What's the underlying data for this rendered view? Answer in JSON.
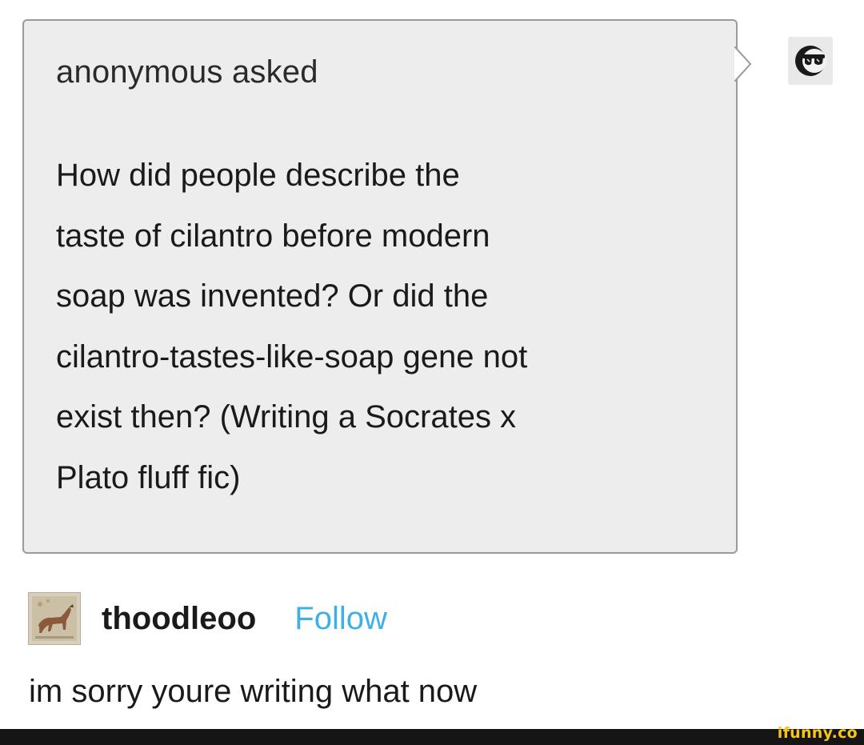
{
  "ask": {
    "asker": "anonymous",
    "verb": "asked",
    "question_lines": [
      "How did people describe the",
      "taste of cilantro before modern",
      "soap was invented? Or did the",
      "cilantro-tastes-like-soap gene not",
      "exist then? (Writing a Socrates x",
      "Plato fluff fic)"
    ],
    "avatar_icon": "anon-sunglasses-icon"
  },
  "answer": {
    "blog_name": "thoodleoo",
    "follow_label": "Follow",
    "text": "im sorry youre writing what now",
    "avatar_icon": "horse-mosaic-avatar"
  },
  "watermark": {
    "text": "ifunny.co"
  },
  "colors": {
    "ask_background": "#ededed",
    "ask_border": "#9a9a9a",
    "follow_link": "#3fb0e5",
    "watermark_bar": "#151515",
    "watermark_text": "#f5c518"
  }
}
